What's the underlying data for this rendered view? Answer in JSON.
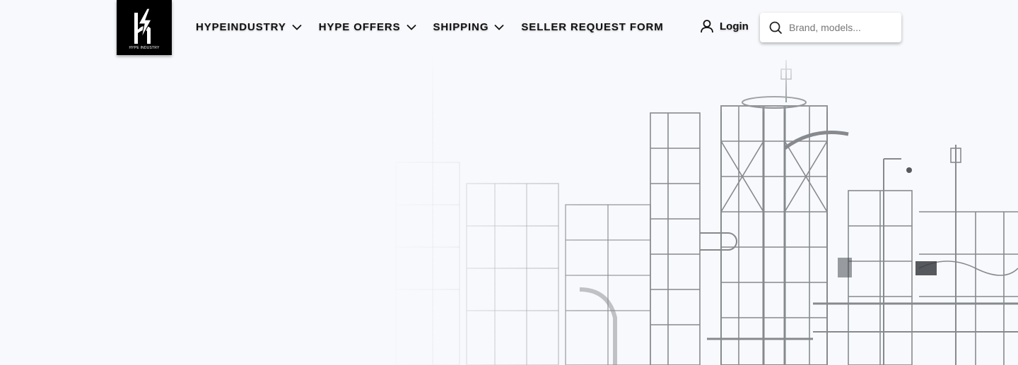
{
  "logo": {
    "alt": "HYPE INDUSTRY",
    "caption": "HYPE INDUSTRY"
  },
  "nav": {
    "items": [
      {
        "label": "HYPEINDUSTRY",
        "has_dropdown": true
      },
      {
        "label": "HYPE OFFERS",
        "has_dropdown": true
      },
      {
        "label": "SHIPPING",
        "has_dropdown": true
      },
      {
        "label": "SELLER REQUEST FORM",
        "has_dropdown": false
      }
    ]
  },
  "login": {
    "label": "Login",
    "icon": "user-icon"
  },
  "search": {
    "placeholder": "Brand, models...",
    "value": "",
    "icon": "search-icon"
  },
  "hero": {
    "image": "industrial-plant-illustration"
  },
  "colors": {
    "background": "#f8f9fc",
    "text": "#111111",
    "logo_bg": "#000000"
  }
}
